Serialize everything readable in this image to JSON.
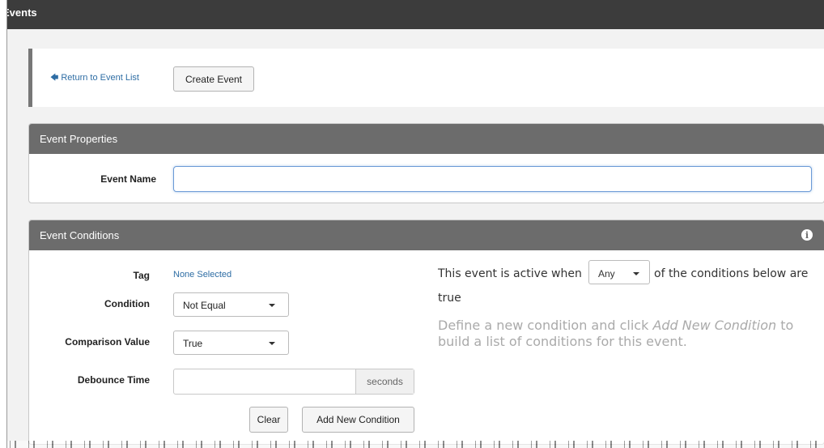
{
  "window": {
    "title": "Events"
  },
  "toolbar": {
    "return_label": "Return to Event List",
    "create_label": "Create Event"
  },
  "properties": {
    "heading": "Event Properties",
    "event_name_label": "Event Name",
    "event_name_value": ""
  },
  "conditions": {
    "heading": "Event Conditions",
    "tag_label": "Tag",
    "tag_value": "None Selected",
    "condition_label": "Condition",
    "condition_value": "Not Equal",
    "comparison_label": "Comparison Value",
    "comparison_value": "True",
    "debounce_label": "Debounce Time",
    "debounce_value": "",
    "debounce_unit": "seconds",
    "clear_label": "Clear",
    "add_label": "Add New Condition",
    "active_prefix": "This event is active when",
    "active_mode": "Any",
    "active_suffix": "of the conditions below are",
    "active_tail": "true",
    "hint_part1": "Define a new condition and click ",
    "hint_action": "Add New Condition",
    "hint_part2": " to build a list of conditions for this event."
  },
  "icons": {
    "return": "arrow-left-icon",
    "info": "info-icon",
    "caret": "chevron-down-icon"
  },
  "colors": {
    "titlebar": "#3c3c3c",
    "panel_header": "#6c6c6c",
    "link": "#2e6da4",
    "focus_border": "#6a9ad6",
    "hint_text": "#aaaaaa"
  }
}
